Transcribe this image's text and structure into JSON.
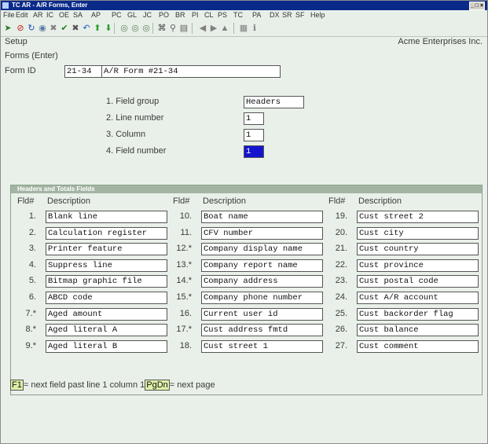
{
  "window": {
    "title": "TC AR - A/R Forms, Enter",
    "close_label": "_ □ ×"
  },
  "menu": [
    "File",
    "Edit",
    "AR",
    "IC",
    "OE",
    "SA",
    "AP",
    "PC",
    "GL",
    "JC",
    "PO",
    "BR",
    "PI",
    "CL",
    "PS",
    "TC",
    "PA",
    "DX",
    "SR",
    "SF",
    "Help"
  ],
  "toolbar": [
    {
      "icon": "tag-icon",
      "glyph": "➤",
      "color": "#2a7a2a"
    },
    {
      "icon": "cancel-icon",
      "glyph": "⊘",
      "color": "#c02020"
    },
    {
      "icon": "refresh-icon",
      "glyph": "↻",
      "color": "#2050c0"
    },
    {
      "icon": "find-icon",
      "glyph": "◉",
      "color": "#5a7aa0"
    },
    {
      "icon": "delete-icon",
      "glyph": "✖",
      "color": "#808080"
    },
    {
      "icon": "check-icon",
      "glyph": "✔",
      "color": "#208020"
    },
    {
      "icon": "close-icon",
      "glyph": "✖",
      "color": "#505050"
    },
    {
      "icon": "undo-icon",
      "glyph": "↶",
      "color": "#2060c0"
    },
    {
      "icon": "up-icon",
      "glyph": "⬆",
      "color": "#30a030"
    },
    {
      "icon": "down-icon",
      "glyph": "⬇",
      "color": "#30a030"
    },
    {
      "icon": "first-icon",
      "glyph": "◎",
      "color": "#608060"
    },
    {
      "icon": "prev-icon",
      "glyph": "◎",
      "color": "#608060"
    },
    {
      "icon": "next-icon",
      "glyph": "◎",
      "color": "#608060"
    },
    {
      "icon": "binoculars-icon",
      "glyph": "⌘",
      "color": "#404040"
    },
    {
      "icon": "zoom-icon",
      "glyph": "⚲",
      "color": "#606060"
    },
    {
      "icon": "list-icon",
      "glyph": "▤",
      "color": "#606060"
    },
    {
      "icon": "back-icon",
      "glyph": "◀",
      "color": "#808080"
    },
    {
      "icon": "forward-icon",
      "glyph": "▶",
      "color": "#808080"
    },
    {
      "icon": "home-icon",
      "glyph": "▲",
      "color": "#808080"
    },
    {
      "icon": "print-icon",
      "glyph": "▦",
      "color": "#808080"
    },
    {
      "icon": "info-icon",
      "glyph": "ℹ",
      "color": "#808080"
    }
  ],
  "header": {
    "setup": "Setup",
    "company": "Acme Enterprises Inc.",
    "mode": "Forms (Enter)"
  },
  "form": {
    "id_label": "Form ID",
    "id_value": "21-34",
    "desc_value": "A/R Form #21-34",
    "fields": [
      {
        "label": "1. Field group",
        "value": "Headers"
      },
      {
        "label": "2. Line number",
        "value": "1"
      },
      {
        "label": "3. Column",
        "value": "1"
      },
      {
        "label": "4. Field number",
        "value": "1"
      }
    ]
  },
  "panel": {
    "title": "Headers and Totals Fields",
    "col_num": "Fld#",
    "col_desc": "Description",
    "rows": [
      {
        "n": "1.",
        "d": "Blank line"
      },
      {
        "n": "2.",
        "d": "Calculation register"
      },
      {
        "n": "3.",
        "d": "Printer feature"
      },
      {
        "n": "4.",
        "d": "Suppress line"
      },
      {
        "n": "5.",
        "d": "Bitmap graphic file"
      },
      {
        "n": "6.",
        "d": "ABCD code"
      },
      {
        "n": "7.*",
        "d": "Aged amount"
      },
      {
        "n": "8.*",
        "d": "Aged literal A"
      },
      {
        "n": "9.*",
        "d": "Aged literal B"
      },
      {
        "n": "10.",
        "d": "Boat name"
      },
      {
        "n": "11.",
        "d": "CFV number"
      },
      {
        "n": "12.*",
        "d": "Company display name"
      },
      {
        "n": "13.*",
        "d": "Company report name"
      },
      {
        "n": "14.*",
        "d": "Company address"
      },
      {
        "n": "15.*",
        "d": "Company phone number"
      },
      {
        "n": "16.",
        "d": "Current user id"
      },
      {
        "n": "17.*",
        "d": "Cust address fmtd"
      },
      {
        "n": "18.",
        "d": "Cust street 1"
      },
      {
        "n": "19.",
        "d": "Cust street 2"
      },
      {
        "n": "20.",
        "d": "Cust city"
      },
      {
        "n": "21.",
        "d": "Cust country"
      },
      {
        "n": "22.",
        "d": "Cust province"
      },
      {
        "n": "23.",
        "d": "Cust postal code"
      },
      {
        "n": "24.",
        "d": "Cust A/R account"
      },
      {
        "n": "25.",
        "d": "Cust backorder flag"
      },
      {
        "n": "26.",
        "d": "Cust balance"
      },
      {
        "n": "27.",
        "d": "Cust comment"
      }
    ]
  },
  "status": {
    "key1": "F1",
    "text1": "= next field past line 1 column 1",
    "key2": "PgDn",
    "text2": "= next page"
  }
}
